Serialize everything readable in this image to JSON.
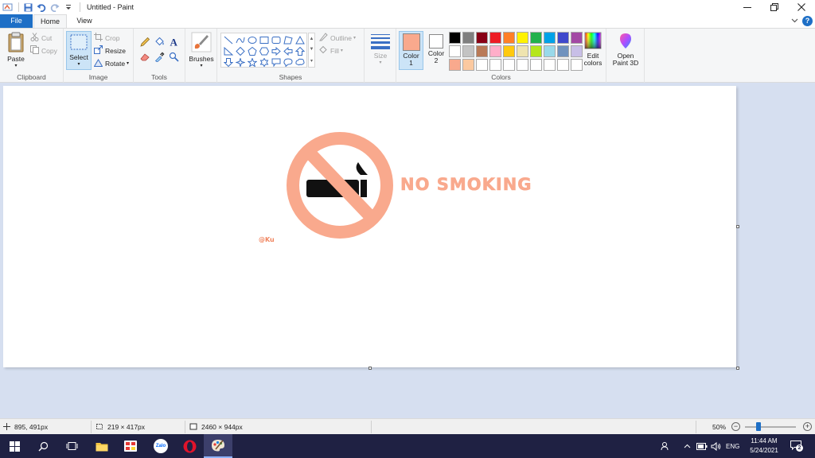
{
  "window": {
    "title": "Untitled - Paint"
  },
  "ribbon_tabs": {
    "file": "File",
    "home": "Home",
    "view": "View"
  },
  "clipboard": {
    "paste": "Paste",
    "cut": "Cut",
    "copy": "Copy",
    "label": "Clipboard"
  },
  "image": {
    "select": "Select",
    "crop": "Crop",
    "resize": "Resize",
    "rotate": "Rotate",
    "label": "Image"
  },
  "tools": {
    "label": "Tools"
  },
  "brushes": {
    "label": "Brushes"
  },
  "shapes": {
    "outline": "Outline",
    "fill": "Fill",
    "label": "Shapes"
  },
  "size": {
    "label": "Size"
  },
  "colors": {
    "color1_label": "Color",
    "color1_num": "1",
    "color2_label": "Color",
    "color2_num": "2",
    "color1_value": "#f9a98d",
    "color2_value": "#ffffff",
    "edit_line1": "Edit",
    "edit_line2": "colors",
    "label": "Colors",
    "palette_row1": [
      "#000000",
      "#7f7f7f",
      "#880015",
      "#ed1c24",
      "#ff7f27",
      "#fff200",
      "#22b14c",
      "#00a2e8",
      "#3f48cc",
      "#a349a4"
    ],
    "palette_row2": [
      "#ffffff",
      "#c3c3c3",
      "#b97a57",
      "#ffaec9",
      "#ffc90e",
      "#efe4b0",
      "#b5e61d",
      "#99d9ea",
      "#7092be",
      "#c8bfe7"
    ],
    "palette_row3": [
      "#f9a98d",
      "#fbc9a0",
      "#ffffff",
      "#ffffff",
      "#ffffff",
      "#ffffff",
      "#ffffff",
      "#ffffff",
      "#ffffff",
      "#ffffff"
    ]
  },
  "paint3d": {
    "line1": "Open",
    "line2": "Paint 3D"
  },
  "canvas": {
    "headline": "NO SMOKING",
    "signature": "@Ku",
    "accent": "#f9a98d"
  },
  "statusbar": {
    "cursor_pos": "895, 491px",
    "selection_size": "219 × 417px",
    "image_size": "2460 × 944px",
    "zoom": "50%"
  },
  "taskbar": {
    "zalo_label": "Zalo",
    "language": "ENG",
    "time": "11:44 AM",
    "date": "5/24/2021",
    "notifications": "2"
  }
}
